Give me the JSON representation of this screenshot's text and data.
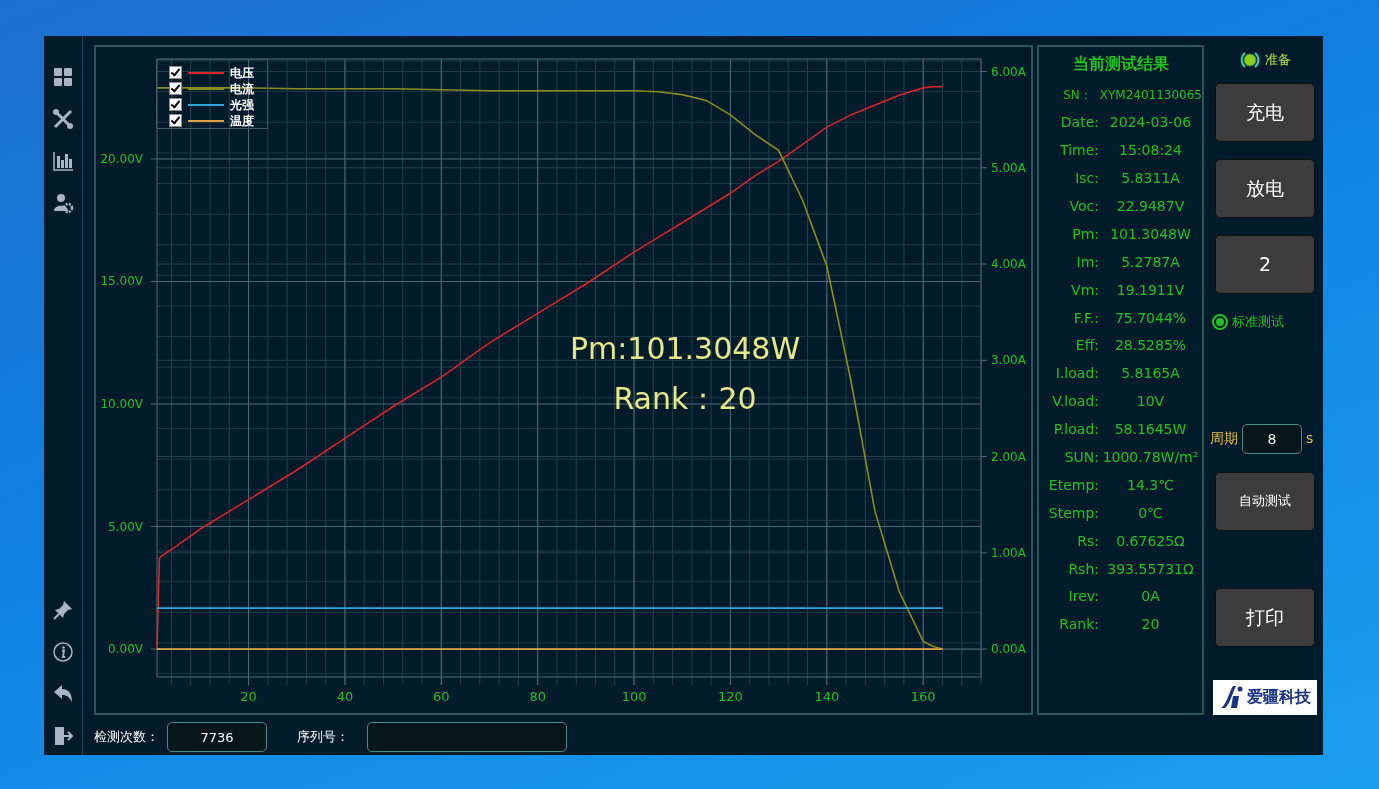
{
  "chart": {
    "chart_data": {
      "type": "line",
      "x": [
        1,
        1.5,
        2,
        5,
        10,
        20,
        30,
        40,
        50,
        60,
        70,
        80,
        90,
        100,
        105,
        110,
        115,
        120,
        125,
        130,
        135,
        140,
        145,
        150,
        155,
        160,
        162,
        164
      ],
      "xlim": [
        1,
        172
      ],
      "ylim": [
        -1.14,
        24.08
      ],
      "y2lim": [
        -0.29,
        6.13
      ],
      "xticks": [
        20,
        40,
        60,
        80,
        100,
        120,
        140,
        160
      ],
      "yticks": [
        {
          "value": 0,
          "label": "0.00V"
        },
        {
          "value": 5,
          "label": "5.00V"
        },
        {
          "value": 10,
          "label": "10.00V"
        },
        {
          "value": 15,
          "label": "15.00V"
        },
        {
          "value": 20,
          "label": "20.00V"
        }
      ],
      "y2ticks": [
        {
          "value": 0,
          "label": "0.00A"
        },
        {
          "value": 1,
          "label": "1.00A"
        },
        {
          "value": 2,
          "label": "2.00A"
        },
        {
          "value": 3,
          "label": "3.00A"
        },
        {
          "value": 4,
          "label": "4.00A"
        },
        {
          "value": 5,
          "label": "5.00A"
        },
        {
          "value": 6,
          "label": "6.00A"
        }
      ],
      "series": [
        {
          "name": "电压",
          "color": "#d8242a",
          "values": [
            0,
            3.7,
            3.8,
            4.2,
            4.9,
            6.1,
            7.3,
            8.6,
            9.9,
            11.1,
            12.5,
            13.7,
            14.9,
            16.2,
            16.8,
            17.4,
            18.0,
            18.6,
            19.3,
            19.9,
            20.6,
            21.3,
            21.8,
            22.2,
            22.6,
            22.9,
            22.95,
            22.95
          ]
        },
        {
          "name": "电流",
          "color": "#8c8c1e",
          "axis": "y2",
          "values": [
            5.83,
            5.83,
            5.83,
            null,
            5.83,
            5.83,
            5.82,
            5.82,
            5.82,
            5.81,
            5.8,
            5.8,
            5.8,
            5.8,
            5.79,
            5.76,
            5.7,
            5.55,
            5.35,
            5.18,
            4.66,
            3.98,
            2.79,
            1.43,
            0.6,
            0.08,
            0.03,
            0
          ]
        },
        {
          "name": "光强",
          "color": "#2ea6e0",
          "values": [
            1.67,
            1.67,
            1.67,
            1.67,
            1.67,
            1.67,
            1.67,
            1.67,
            1.67,
            1.67,
            1.67,
            1.67,
            1.67,
            1.67,
            1.67,
            1.67,
            1.67,
            1.67,
            1.67,
            1.67,
            1.67,
            1.67,
            1.67,
            1.67,
            1.67,
            1.67,
            1.67,
            1.67
          ]
        },
        {
          "name": "温度",
          "color": "#e0a048",
          "values": [
            0,
            0,
            0,
            0,
            0,
            0,
            0,
            0,
            0,
            0,
            0,
            0,
            0,
            0,
            0,
            0,
            0,
            0,
            0,
            0,
            0,
            0,
            0,
            0,
            0,
            0,
            0,
            0
          ]
        }
      ],
      "annotations": [
        "Pm:101.3048W",
        "Rank：20"
      ],
      "grid": true
    },
    "legend": [
      {
        "checked": true
      },
      {
        "checked": true
      },
      {
        "checked": true
      },
      {
        "checked": true
      }
    ]
  },
  "results": {
    "title": "当前测试结果",
    "rows": [
      {
        "label": "SN：",
        "value": "XYM2401130065",
        "kind": "small"
      },
      {
        "label": "Date:",
        "value": "2024-03-06",
        "kind": "normal"
      },
      {
        "label": "Time:",
        "value": "15:08:24",
        "kind": "normal"
      },
      {
        "label": "Isc:",
        "value": "5.8311A",
        "kind": "normal"
      },
      {
        "label": "Voc:",
        "value": "22.9487V",
        "kind": "normal"
      },
      {
        "label": "Pm:",
        "value": "101.3048W",
        "kind": "normal"
      },
      {
        "label": "Im:",
        "value": "5.2787A",
        "kind": "normal"
      },
      {
        "label": "Vm:",
        "value": "19.1911V",
        "kind": "normal"
      },
      {
        "label": "F.F.:",
        "value": "75.7044%",
        "kind": "normal"
      },
      {
        "label": "Eff:",
        "value": "28.5285%",
        "kind": "normal"
      },
      {
        "label": "I.load:",
        "value": "5.8165A",
        "kind": "normal"
      },
      {
        "label": "V.load:",
        "value": "10V",
        "kind": "normal"
      },
      {
        "label": "P.load:",
        "value": "58.1645W",
        "kind": "normal"
      },
      {
        "label": "SUN:",
        "value": "1000.78W/m²",
        "kind": "normal"
      },
      {
        "label": "Etemp:",
        "value": "14.3℃",
        "kind": "normal"
      },
      {
        "label": "Stemp:",
        "value": "0℃",
        "kind": "normal"
      },
      {
        "label": "Rs:",
        "value": "0.67625Ω",
        "kind": "normal"
      },
      {
        "label": "Rsh:",
        "value": "393.55731Ω",
        "kind": "normal"
      },
      {
        "label": "Irev:",
        "value": "0A",
        "kind": "normal"
      },
      {
        "label": "Rank:",
        "value": "20",
        "kind": "normal"
      }
    ]
  },
  "status": {
    "label": "准备",
    "on": true
  },
  "buttons": [
    "充电",
    "放电",
    "2"
  ],
  "mode": {
    "label": "标准测试",
    "selected": true
  },
  "period": {
    "label": "周期",
    "value": "8",
    "unit": "s"
  },
  "auto_button": "自动测试",
  "print_button": "打印",
  "logo": {
    "text": "爱疆科技"
  },
  "bottom": {
    "count_label": "检测次数：",
    "count_value": "7736",
    "serial_label": "序列号："
  }
}
